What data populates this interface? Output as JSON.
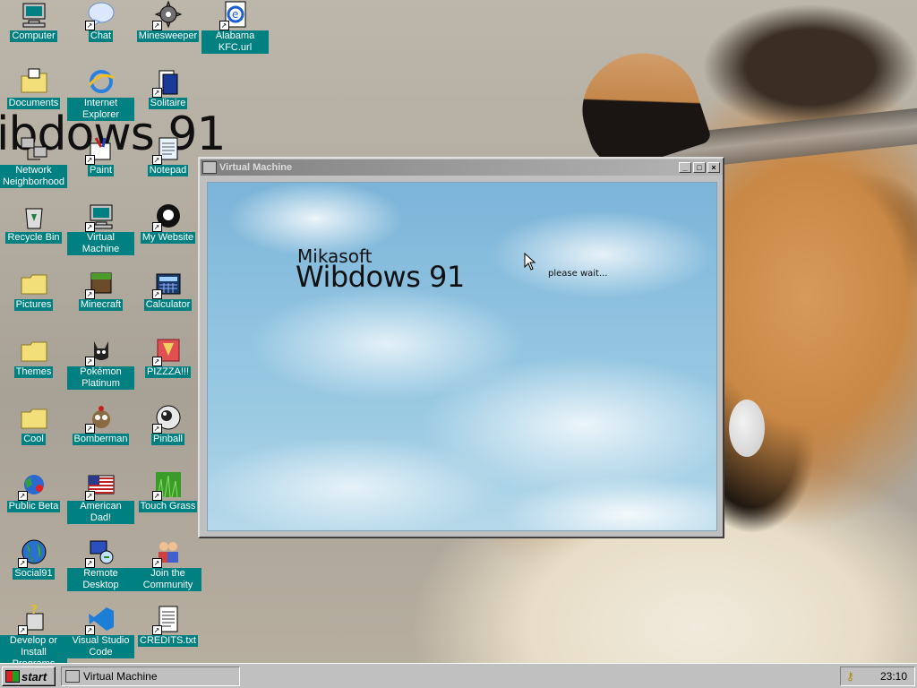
{
  "desktop": {
    "watermark": "ibdows 91",
    "icons": [
      {
        "label": "Computer",
        "icon": "computer-icon",
        "shortcut": false
      },
      {
        "label": "Chat",
        "icon": "chat-bubble-icon",
        "shortcut": true
      },
      {
        "label": "Minesweeper",
        "icon": "gear-icon",
        "shortcut": true
      },
      {
        "label": "Alabama KFC.url",
        "icon": "internet-shortcut-icon",
        "shortcut": true
      },
      {
        "label": "Documents",
        "icon": "folder-documents-icon",
        "shortcut": false
      },
      {
        "label": "Internet Explorer",
        "icon": "internet-explorer-icon",
        "shortcut": false
      },
      {
        "label": "Solitaire",
        "icon": "solitaire-icon",
        "shortcut": true
      },
      {
        "label": "Network Neighborhood",
        "icon": "network-icon",
        "shortcut": false
      },
      {
        "label": "Paint",
        "icon": "paint-icon",
        "shortcut": true
      },
      {
        "label": "Notepad",
        "icon": "notepad-icon",
        "shortcut": true
      },
      {
        "label": "Recycle Bin",
        "icon": "recycle-bin-icon",
        "shortcut": false
      },
      {
        "label": "Virtual Machine",
        "icon": "computer-icon",
        "shortcut": true
      },
      {
        "label": "My Website",
        "icon": "github-icon",
        "shortcut": true
      },
      {
        "label": "Pictures",
        "icon": "folder-icon",
        "shortcut": false
      },
      {
        "label": "Minecraft",
        "icon": "minecraft-icon",
        "shortcut": true
      },
      {
        "label": "Calculator",
        "icon": "calculator-icon",
        "shortcut": true
      },
      {
        "label": "Themes",
        "icon": "folder-icon",
        "shortcut": false
      },
      {
        "label": "Pokémon Platinum",
        "icon": "pokemon-icon",
        "shortcut": true
      },
      {
        "label": "PIZZZA!!!",
        "icon": "pizza-icon",
        "shortcut": true
      },
      {
        "label": "Cool",
        "icon": "folder-icon",
        "shortcut": false
      },
      {
        "label": "Bomberman",
        "icon": "bomberman-icon",
        "shortcut": true
      },
      {
        "label": "Pinball",
        "icon": "pinball-icon",
        "shortcut": true
      },
      {
        "label": "Public Beta",
        "icon": "public-beta-icon",
        "shortcut": true
      },
      {
        "label": "American Dad!",
        "icon": "us-flag-icon",
        "shortcut": true
      },
      {
        "label": "Touch Grass",
        "icon": "grass-icon",
        "shortcut": true
      },
      {
        "label": "Social91",
        "icon": "globe-icon",
        "shortcut": true
      },
      {
        "label": "Remote Desktop",
        "icon": "remote-desktop-icon",
        "shortcut": true
      },
      {
        "label": "Join the Community",
        "icon": "community-icon",
        "shortcut": true
      },
      {
        "label": "Develop or Install Programs",
        "icon": "develop-icon",
        "shortcut": true
      },
      {
        "label": "Visual Studio Code",
        "icon": "vscode-icon",
        "shortcut": true
      },
      {
        "label": "CREDITS.txt",
        "icon": "text-file-icon",
        "shortcut": true
      }
    ]
  },
  "window": {
    "title": "Virtual Machine",
    "minimize": "_",
    "maximize": "□",
    "close": "×",
    "screen": {
      "brand_small": "Mikasoft",
      "brand_big": "Wibdows 91",
      "status": "please wait..."
    }
  },
  "taskbar": {
    "start_label": "start",
    "tasks": [
      {
        "label": "Virtual Machine"
      }
    ],
    "clock": "23:10"
  },
  "colors": {
    "desktop_label_bg": "#008080",
    "window_face": "#c0c0c0"
  }
}
